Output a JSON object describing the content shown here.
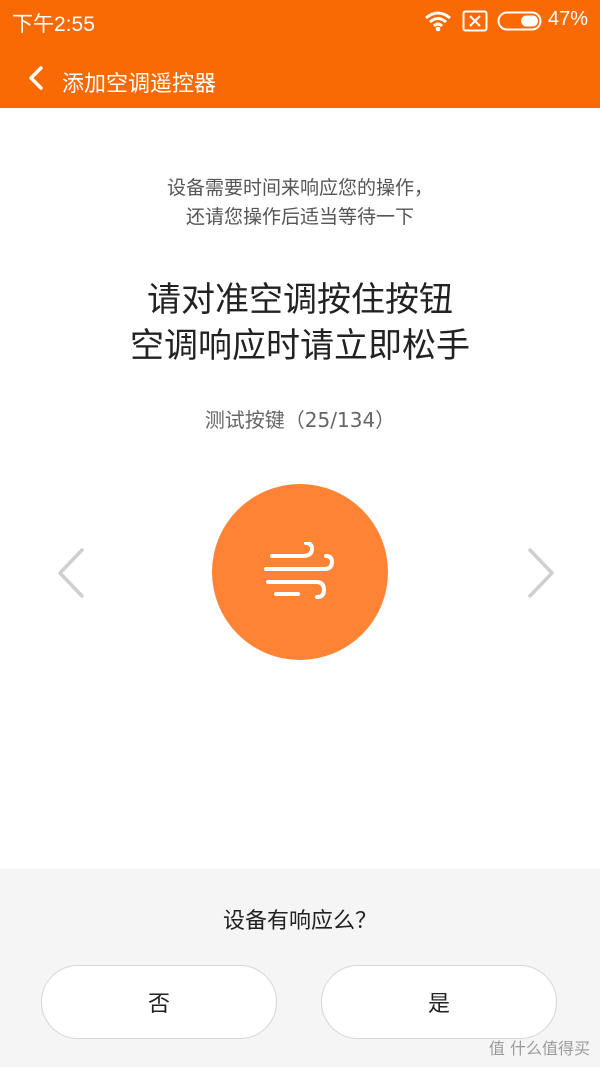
{
  "status_bar": {
    "time": "下午2:55",
    "battery": "47%",
    "icons": [
      "wifi-icon",
      "sim-icon",
      "battery-icon"
    ]
  },
  "nav": {
    "title": "添加空调遥控器",
    "back_icon": "chevron-left-icon"
  },
  "hint": {
    "line1": "设备需要时间来响应您的操作，",
    "line2": "还请您操作后适当等待一下"
  },
  "instruction": {
    "line1": "请对准空调按住按钮",
    "line2": "空调响应时请立即松手"
  },
  "progress": {
    "text": "测试按键（25/134）",
    "current": 25,
    "total": 134
  },
  "test_button": {
    "icon": "wind-icon",
    "color": "#ff8335"
  },
  "confirm": {
    "question": "设备有响应么？",
    "no_label": "否",
    "yes_label": "是"
  },
  "watermark": "值 什么值得买",
  "colors": {
    "accent": "#f96a05"
  }
}
